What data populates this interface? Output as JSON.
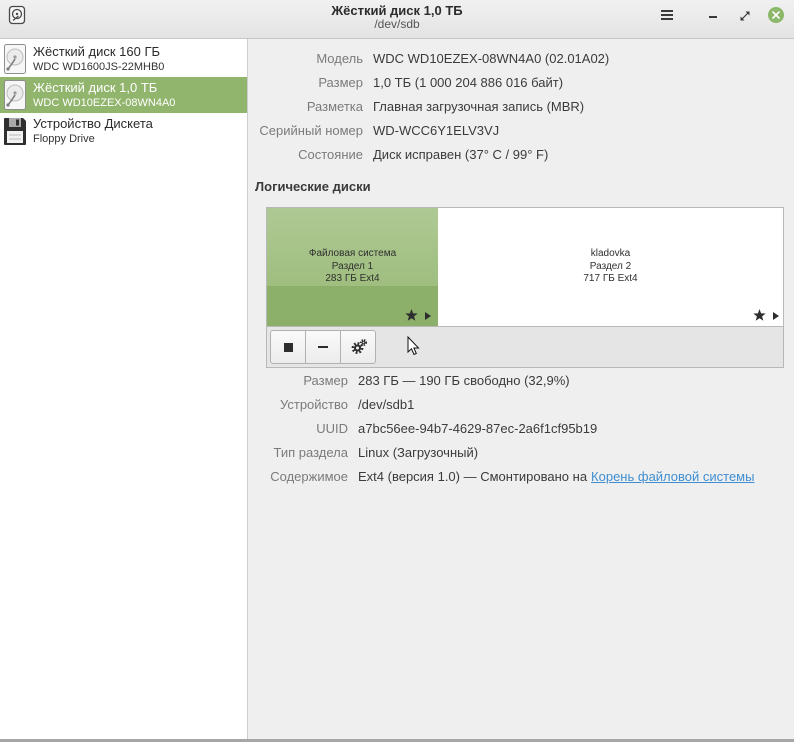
{
  "window": {
    "title": "Жёсткий диск 1,0 ТБ",
    "subtitle": "/dev/sdb"
  },
  "icons": {
    "app": "disks-app-icon",
    "menu": "hamburger-icon",
    "minimize": "minimize-icon",
    "maximize": "maximize-icon",
    "close": "close-icon",
    "partition_mark": "star-icon",
    "partition_expand": "triangle-right-icon",
    "unmount": "stop-icon",
    "delete": "minus-icon",
    "settings": "gear-icon"
  },
  "sidebar": {
    "items": [
      {
        "title": "Жёсткий диск 160 ГБ",
        "subtitle": "WDC WD1600JS-22MHB0",
        "icon": "hard-disk-icon",
        "selected": false
      },
      {
        "title": "Жёсткий диск 1,0 ТБ",
        "subtitle": "WDC WD10EZEX-08WN4A0",
        "icon": "hard-disk-icon",
        "selected": true
      },
      {
        "title": "Устройство Дискета",
        "subtitle": "Floppy Drive",
        "icon": "floppy-disk-icon",
        "selected": false
      }
    ]
  },
  "drive": {
    "rows": [
      {
        "label": "Модель",
        "value": "WDC WD10EZEX-08WN4A0 (02.01A02)"
      },
      {
        "label": "Размер",
        "value": "1,0 ТБ (1 000 204 886 016 байт)"
      },
      {
        "label": "Разметка",
        "value": "Главная загрузочная запись (MBR)"
      },
      {
        "label": "Серийный номер",
        "value": "WD-WCC6Y1ELV3VJ"
      },
      {
        "label": "Состояние",
        "value": "Диск исправен (37° C / 99° F)"
      }
    ]
  },
  "volumes": {
    "heading": "Логические диски",
    "partitions": [
      {
        "lines": [
          "Файловая система",
          "Раздел 1",
          "283 ГБ Ext4"
        ],
        "selected": true
      },
      {
        "lines": [
          "kladovka",
          "Раздел 2",
          "717 ГБ Ext4"
        ],
        "selected": false
      }
    ]
  },
  "volume": {
    "rows": [
      {
        "label": "Размер",
        "value": "283 ГБ — 190 ГБ свободно (32,9%)"
      },
      {
        "label": "Устройство",
        "value": "/dev/sdb1"
      },
      {
        "label": "UUID",
        "value": "a7bc56ee-94b7-4629-87ec-2a6f1cf95b19"
      },
      {
        "label": "Тип раздела",
        "value": "Linux (Загрузочный)"
      }
    ],
    "contents": {
      "label": "Содержимое",
      "value": "Ext4 (версия 1.0) — Смонтировано на",
      "link": "Корень файловой системы"
    }
  },
  "colors": {
    "accent": "#92b56e",
    "partition_selected_top": "#afc994",
    "partition_selected_bottom": "#8caf69",
    "link": "#3f8ed1",
    "close_button": "#8cb869"
  }
}
